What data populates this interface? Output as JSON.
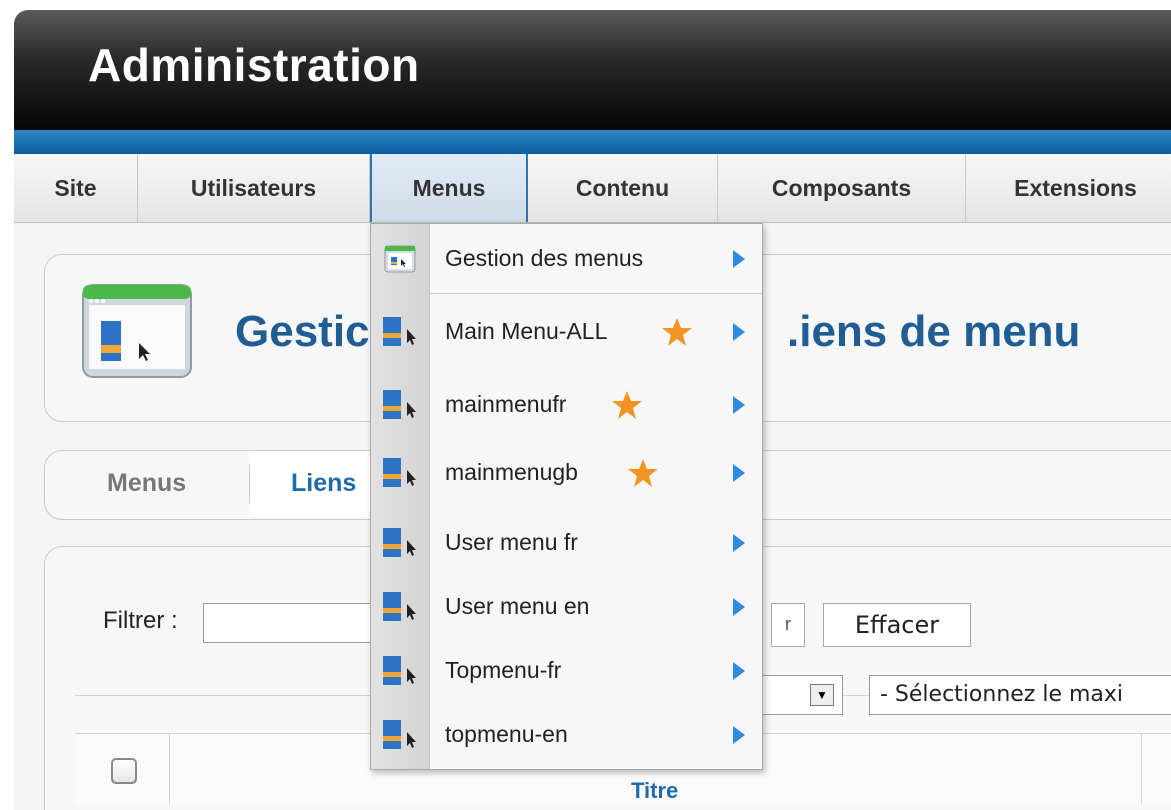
{
  "header": {
    "title": "Administration"
  },
  "nav": {
    "items": [
      {
        "label": "Site"
      },
      {
        "label": "Utilisateurs"
      },
      {
        "label": "Menus"
      },
      {
        "label": "Contenu"
      },
      {
        "label": "Composants"
      },
      {
        "label": "Extensions"
      }
    ]
  },
  "page": {
    "title_left": "Gestic",
    "title_right": ".iens de menu"
  },
  "tabs": {
    "menus": "Menus",
    "liens": "Liens"
  },
  "filter": {
    "label": "Filtrer :",
    "go_label": "r",
    "clear_label": "Effacer",
    "max_select": "- Sélectionnez le maxi"
  },
  "table": {
    "col_title": "Titre"
  },
  "dropdown": {
    "items": [
      {
        "label": "Gestion des menus",
        "star": false
      },
      {
        "label": "Main Menu-ALL",
        "star": true
      },
      {
        "label": "mainmenufr",
        "star": true
      },
      {
        "label": "mainmenugb",
        "star": true
      },
      {
        "label": "User menu fr",
        "star": false
      },
      {
        "label": "User menu en",
        "star": false
      },
      {
        "label": "Topmenu-fr",
        "star": false
      },
      {
        "label": "topmenu-en",
        "star": false
      }
    ]
  },
  "colors": {
    "accent_blue": "#1f5d92",
    "arrow_blue": "#2d8be0",
    "star_orange": "#f29421"
  }
}
